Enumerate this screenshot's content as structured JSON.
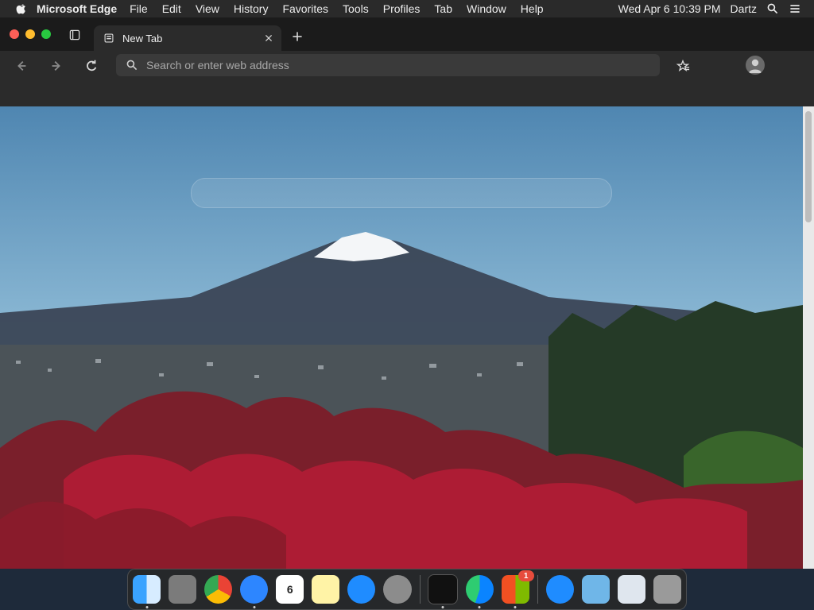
{
  "menubar": {
    "app_name": "Microsoft Edge",
    "items": [
      "File",
      "Edit",
      "View",
      "History",
      "Favorites",
      "Tools",
      "Profiles",
      "Tab",
      "Window",
      "Help"
    ],
    "datetime": "Wed Apr 6  10:39 PM",
    "user": "Dartz"
  },
  "browser": {
    "tab_title": "New Tab",
    "address_placeholder": "Search or enter web address"
  },
  "dock": {
    "calendar_day": "6",
    "appstore_badge": "1"
  },
  "colors": {
    "close": "#ff5f57",
    "minimize": "#febc2e",
    "maximize": "#28c840"
  }
}
